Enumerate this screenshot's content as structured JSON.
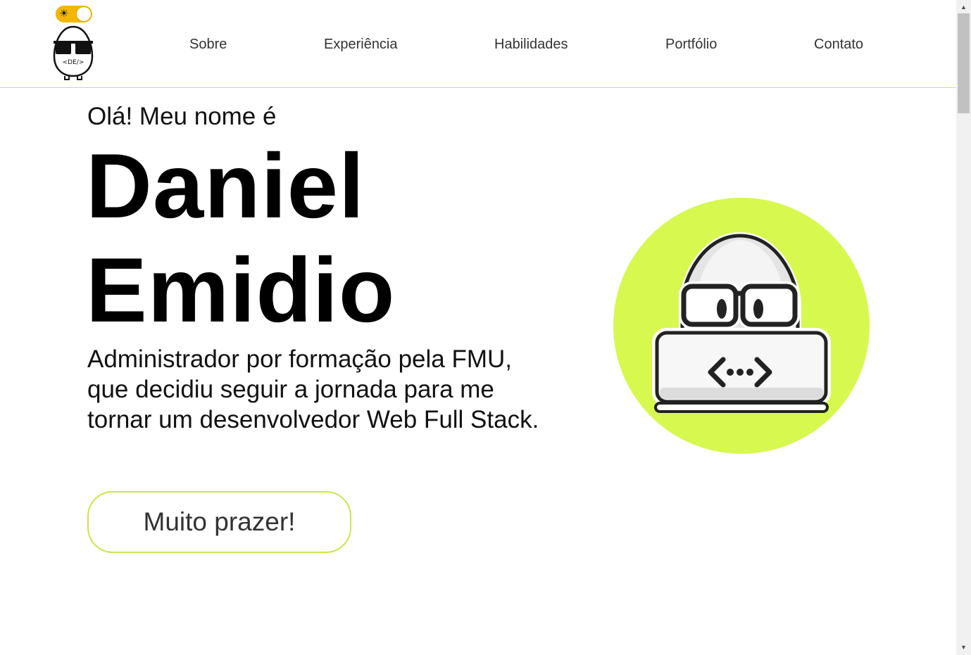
{
  "header": {
    "theme_toggle": {
      "state": "light",
      "icon": "sun-icon"
    },
    "logo": {
      "text": "<DE/>"
    },
    "nav": [
      {
        "label": "Sobre"
      },
      {
        "label": "Experiência"
      },
      {
        "label": "Habilidades"
      },
      {
        "label": "Portfólio"
      },
      {
        "label": "Contato"
      }
    ]
  },
  "hero": {
    "greeting": "Olá! Meu nome é",
    "first_name": "Daniel",
    "last_name": "Emidio",
    "description": "Administrador por formação pela FMU, que decidiu seguir a jornada para me tornar um desenvolvedor Web Full Stack.",
    "cta_label": "Muito prazer!",
    "illustration": {
      "icon": "code-egg-laptop-icon",
      "code_symbol": "<•••>"
    }
  },
  "colors": {
    "accent": "#d7f84f",
    "accent_border": "#c6e84a",
    "toggle": "#f2b705",
    "text": "#111111"
  }
}
